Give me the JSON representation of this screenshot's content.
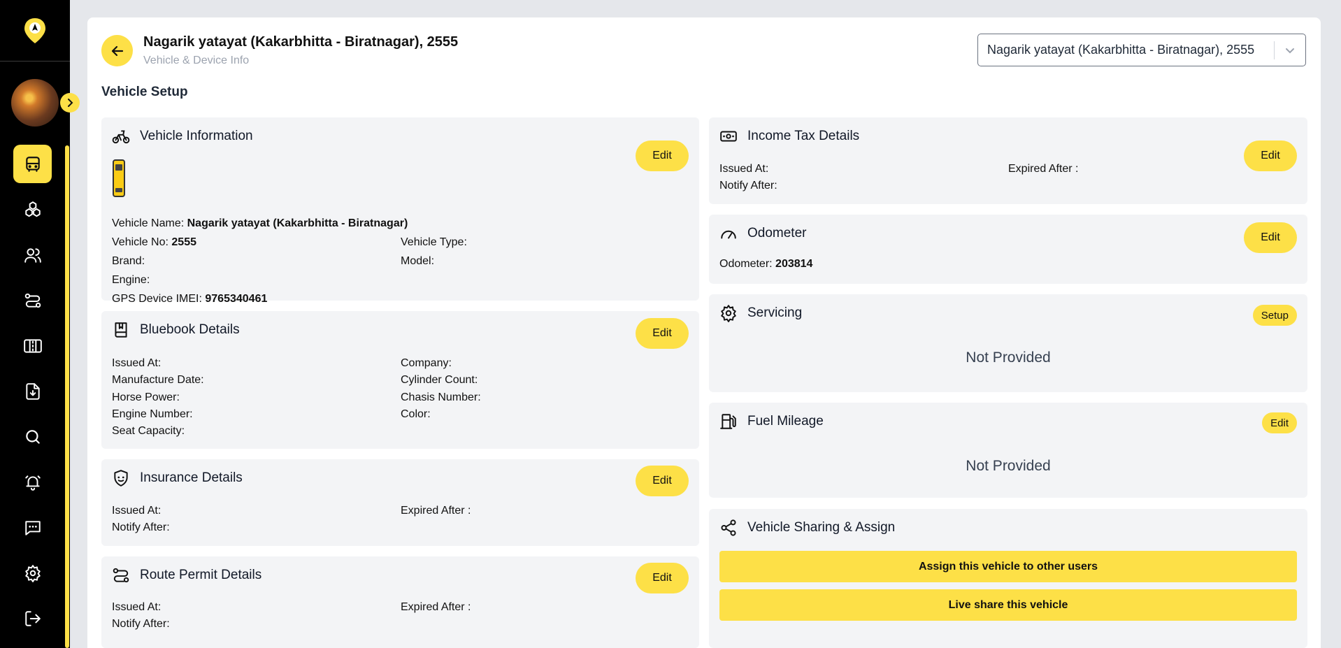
{
  "header": {
    "title": "Nagarik yatayat (Kakarbhitta - Biratnagar), 2555",
    "subtitle": "Vehicle & Device Info",
    "selected_vehicle": "Nagarik yatayat (Kakarbhitta - Biratnagar), 2555"
  },
  "section_title": "Vehicle Setup",
  "sidebar": {
    "items": [
      {
        "icon": "bus-icon"
      },
      {
        "icon": "cubes-icon"
      },
      {
        "icon": "users-icon"
      },
      {
        "icon": "route-icon"
      },
      {
        "icon": "road-icon"
      },
      {
        "icon": "download-file-icon"
      },
      {
        "icon": "search-icon"
      },
      {
        "icon": "alarm-bell-icon"
      },
      {
        "icon": "chat-icon"
      },
      {
        "icon": "gear-icon"
      },
      {
        "icon": "logout-icon"
      }
    ]
  },
  "vehicle_info": {
    "title": "Vehicle Information",
    "edit": "Edit",
    "name_label": "Vehicle Name:",
    "name_value": "Nagarik yatayat (Kakarbhitta - Biratnagar)",
    "no_label": "Vehicle No:",
    "no_value": "2555",
    "type_label": "Vehicle Type:",
    "brand_label": "Brand:",
    "model_label": "Model:",
    "engine_label": "Engine:",
    "imei_label": "GPS Device IMEI:",
    "imei_value": "9765340461"
  },
  "bluebook": {
    "title": "Bluebook Details",
    "edit": "Edit",
    "issued_at": "Issued At:",
    "company": "Company:",
    "manufacture_date": "Manufacture Date:",
    "cylinder_count": "Cylinder Count:",
    "horse_power": "Horse Power:",
    "chasis_number": "Chasis Number:",
    "engine_number": "Engine Number:",
    "color": "Color:",
    "seat_capacity": "Seat Capacity:"
  },
  "insurance": {
    "title": "Insurance Details",
    "edit": "Edit",
    "issued_at": "Issued At:",
    "expired_after": "Expired After :",
    "notify_after": "Notify After:"
  },
  "route_permit": {
    "title": "Route Permit Details",
    "edit": "Edit",
    "issued_at": "Issued At:",
    "expired_after": "Expired After :",
    "notify_after": "Notify After:"
  },
  "income_tax": {
    "title": "Income Tax Details",
    "edit": "Edit",
    "issued_at": "Issued At:",
    "expired_after": "Expired After :",
    "notify_after": "Notify After:"
  },
  "odometer": {
    "title": "Odometer",
    "edit": "Edit",
    "label": "Odometer:",
    "value": "203814"
  },
  "servicing": {
    "title": "Servicing",
    "setup": "Setup",
    "status": "Not Provided"
  },
  "fuel_mileage": {
    "title": "Fuel Mileage",
    "edit": "Edit",
    "status": "Not Provided"
  },
  "sharing": {
    "title": "Vehicle Sharing & Assign",
    "assign_button": "Assign this vehicle to other users",
    "live_share_button": "Live share this vehicle"
  },
  "colors": {
    "accent": "#fde047",
    "sidebar": "#000000",
    "card": "#f3f4f6"
  }
}
